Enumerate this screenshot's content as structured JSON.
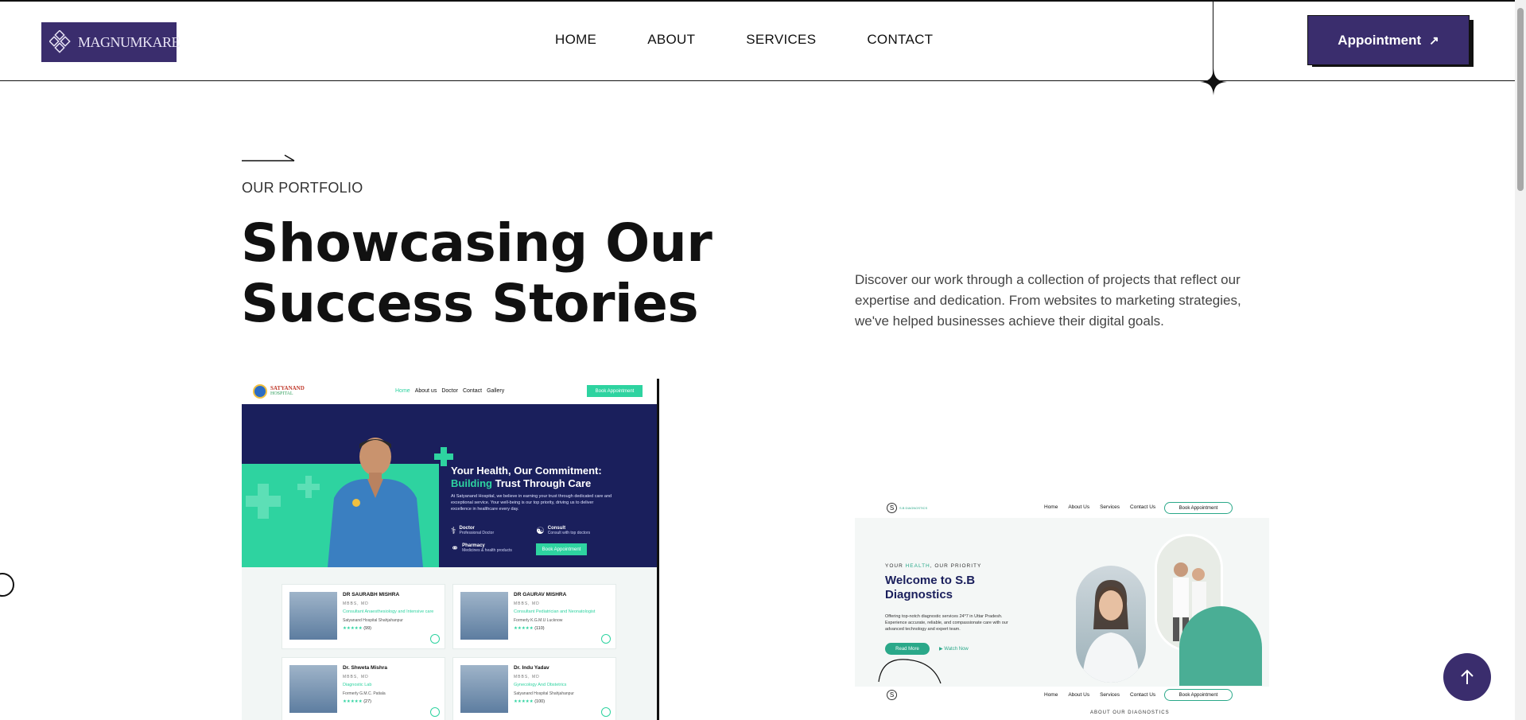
{
  "header": {
    "logo_text": "MAGNUMKARE",
    "nav": [
      "HOME",
      "ABOUT",
      "SERVICES",
      "CONTACT"
    ],
    "appointment_label": "Appointment",
    "appointment_icon": "arrow-up-right-icon"
  },
  "hero": {
    "eyebrow": "OUR PORTFOLIO",
    "title_line1": "Showcasing Our",
    "title_line2": "Success Stories",
    "description": "Discover our work through a collection of projects that reflect our expertise and dedication. From websites to marketing strategies, we've helped businesses achieve their digital goals."
  },
  "portfolio": {
    "project1": {
      "brand_line1": "SATYANAND",
      "brand_line2": "HOSPITAL",
      "nav": [
        "Home",
        "About us",
        "Doctor",
        "Contact",
        "Gallery"
      ],
      "cta": "Book Appointment",
      "headline1": "Your Health, Our Commitment:",
      "headline2_accent": "Building",
      "headline2_rest": " Trust Through Care",
      "body": "At Satyanand Hospital, we believe in earning your trust through dedicated care and exceptional service. Your well-being is our top priority, driving us to deliver excellence in healthcare every day.",
      "features": [
        {
          "title": "Doctor",
          "sub": "Professional Doctor"
        },
        {
          "title": "Consult",
          "sub": "Consult with top doctors"
        },
        {
          "title": "Pharmacy",
          "sub": "Medicines & health products"
        }
      ],
      "hero_button": "Book Appointment",
      "doctors": [
        {
          "name": "DR SAURABH MISHRA",
          "degree": "MBBS, MD",
          "spec": "Consultant Anaesthesiology and Intensive care",
          "place": "Satyanand Hospital Shahjahanpur",
          "rating": "(99)"
        },
        {
          "name": "DR GAURAV MISHRA",
          "degree": "MBBS, MD",
          "spec": "Consultant Pediatrician and Neonatologist",
          "place": "Formerly K.G.M.U Lucknow",
          "rating": "(110)"
        },
        {
          "name": "Dr. Shweta Mishra",
          "degree": "MBBS, MD",
          "spec": "Diagnostic Lab",
          "place": "Formerly G.M.C. Patiala",
          "rating": "(27)"
        },
        {
          "name": "Dr. Indu Yadav",
          "degree": "MBBS, MD",
          "spec": "Gynecology And Obstetrics",
          "place": "Satyanand Hospital Shahjahanpur",
          "rating": "(100)"
        }
      ]
    },
    "project2": {
      "brand": "S.B DIAGNOSTICS",
      "nav": [
        "Home",
        "About Us",
        "Services",
        "Contact Us"
      ],
      "cta": "Book Appointment",
      "eyebrow_pre": "YOUR ",
      "eyebrow_accent": "HEALTH",
      "eyebrow_post": ", OUR PRIORITY",
      "headline1": "Welcome to S.B",
      "headline2": "Diagnostics",
      "body": "Offering top-notch diagnostic services 24*7 in Uttar Pradesh. Experience accurate, reliable, and compassionate care with our advanced technology and expert team.",
      "read_more": "Read More",
      "watch_now": "Watch Now",
      "section_label": "ABOUT OUR DIAGNOSTICS"
    }
  },
  "ui": {
    "scroll_top_icon": "arrow-up-icon",
    "accent": "#3a2d6d",
    "green": "#2ed3a0",
    "navy": "#1a1f5c"
  }
}
